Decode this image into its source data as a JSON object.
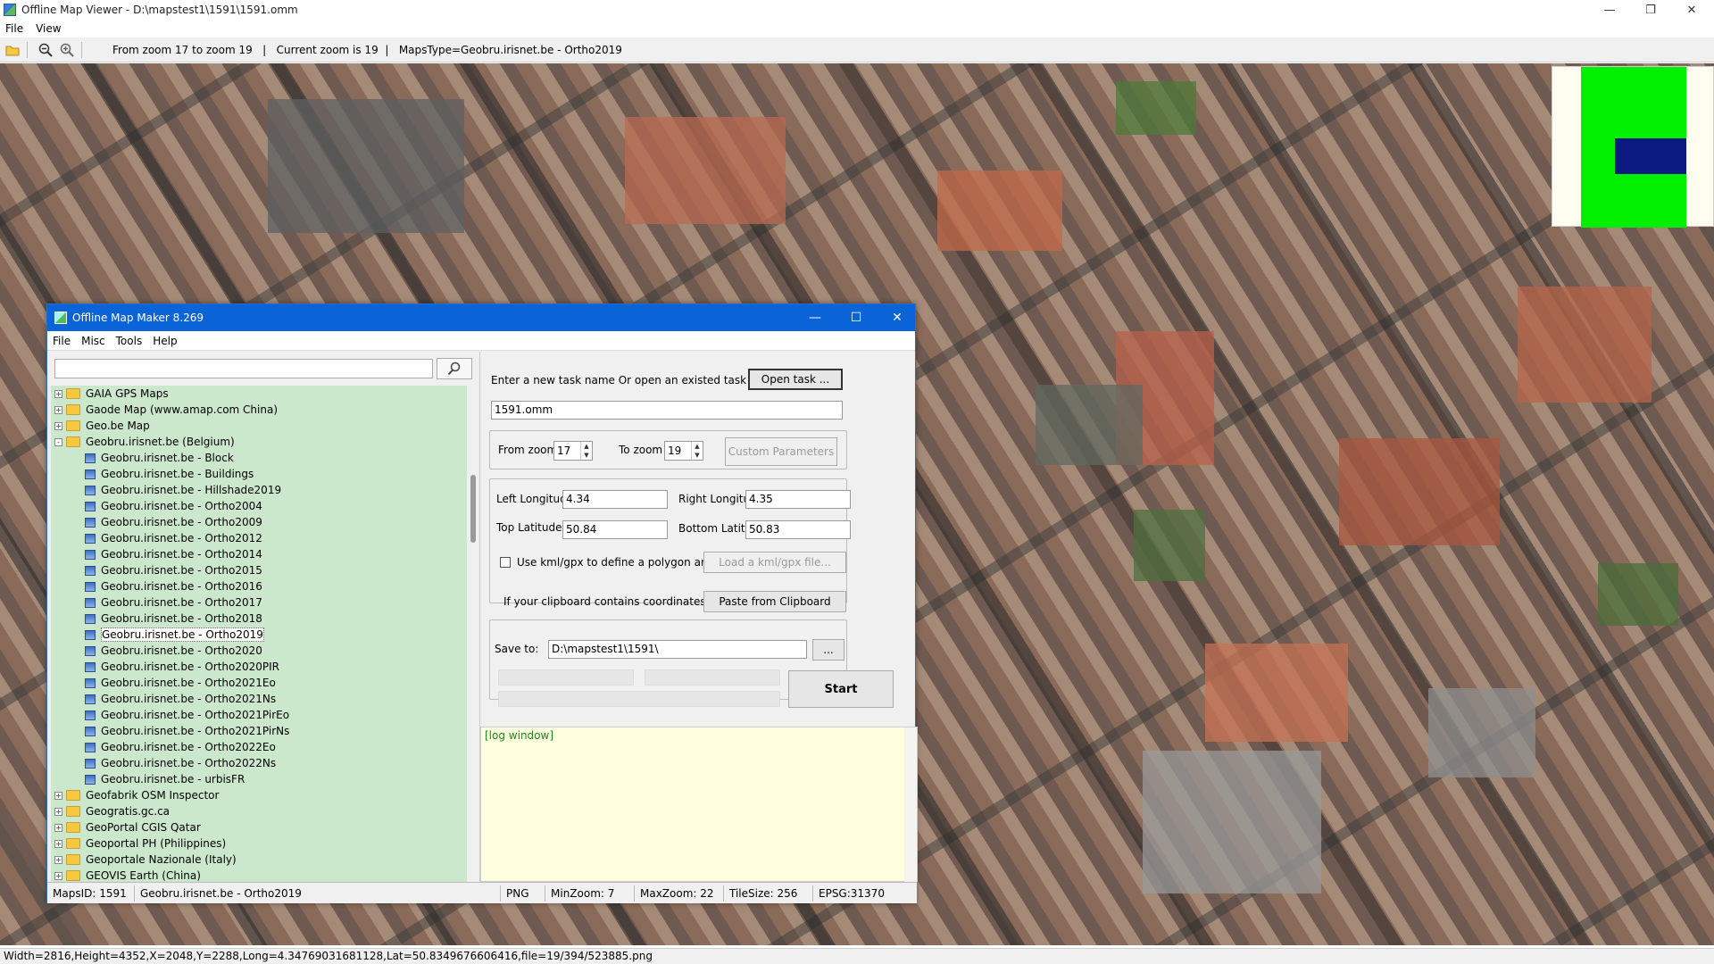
{
  "viewer": {
    "title": "Offline Map Viewer - D:\\mapstest1\\1591\\1591.omm",
    "menu": [
      "File",
      "View"
    ],
    "toolbar_info": "From zoom 17 to zoom 19   |   Current zoom is 19  |   MapsType=Geobru.irisnet.be - Ortho2019",
    "status": "Width=2816,Height=4352,X=2048,Y=2288,Long=4.34769031681128,Lat=50.8349676606416,file=19/394/523885.png",
    "minimap_colors": {
      "bg": "#fffdf0",
      "green": "#00f000",
      "blue": "#0a1a80"
    }
  },
  "dialog": {
    "title": "Offline Map Maker 8.269",
    "menu": [
      "File",
      "Misc",
      "Tools",
      "Help"
    ],
    "search_value": "",
    "tree": [
      {
        "label": "GAIA GPS Maps",
        "type": "folder",
        "expander": "+"
      },
      {
        "label": "Gaode Map (www.amap.com China)",
        "type": "folder",
        "expander": "+"
      },
      {
        "label": "Geo.be Map",
        "type": "folder",
        "expander": "+"
      },
      {
        "label": "Geobru.irisnet.be (Belgium)",
        "type": "folder",
        "expander": "-"
      },
      {
        "label": "Geobru.irisnet.be - Block",
        "type": "leaf"
      },
      {
        "label": "Geobru.irisnet.be - Buildings",
        "type": "leaf"
      },
      {
        "label": "Geobru.irisnet.be - Hillshade2019",
        "type": "leaf"
      },
      {
        "label": "Geobru.irisnet.be - Ortho2004",
        "type": "leaf"
      },
      {
        "label": "Geobru.irisnet.be - Ortho2009",
        "type": "leaf"
      },
      {
        "label": "Geobru.irisnet.be - Ortho2012",
        "type": "leaf"
      },
      {
        "label": "Geobru.irisnet.be - Ortho2014",
        "type": "leaf"
      },
      {
        "label": "Geobru.irisnet.be - Ortho2015",
        "type": "leaf"
      },
      {
        "label": "Geobru.irisnet.be - Ortho2016",
        "type": "leaf"
      },
      {
        "label": "Geobru.irisnet.be - Ortho2017",
        "type": "leaf"
      },
      {
        "label": "Geobru.irisnet.be - Ortho2018",
        "type": "leaf"
      },
      {
        "label": "Geobru.irisnet.be - Ortho2019",
        "type": "leaf",
        "selected": true
      },
      {
        "label": "Geobru.irisnet.be - Ortho2020",
        "type": "leaf"
      },
      {
        "label": "Geobru.irisnet.be - Ortho2020PIR",
        "type": "leaf"
      },
      {
        "label": "Geobru.irisnet.be - Ortho2021Eo",
        "type": "leaf"
      },
      {
        "label": "Geobru.irisnet.be - Ortho2021Ns",
        "type": "leaf"
      },
      {
        "label": "Geobru.irisnet.be - Ortho2021PirEo",
        "type": "leaf"
      },
      {
        "label": "Geobru.irisnet.be - Ortho2021PirNs",
        "type": "leaf"
      },
      {
        "label": "Geobru.irisnet.be - Ortho2022Eo",
        "type": "leaf"
      },
      {
        "label": "Geobru.irisnet.be - Ortho2022Ns",
        "type": "leaf"
      },
      {
        "label": "Geobru.irisnet.be - urbisFR",
        "type": "leaf"
      },
      {
        "label": "Geofabrik OSM Inspector",
        "type": "folder",
        "expander": "+"
      },
      {
        "label": "Geogratis.gc.ca",
        "type": "folder",
        "expander": "+"
      },
      {
        "label": "GeoPortal CGIS Qatar",
        "type": "folder",
        "expander": "+"
      },
      {
        "label": "Geoportal PH (Philippines)",
        "type": "folder",
        "expander": "+"
      },
      {
        "label": "Geoportale Nazionale (Italy)",
        "type": "folder",
        "expander": "+"
      },
      {
        "label": "GEOVIS Earth (China)",
        "type": "folder",
        "expander": "+"
      }
    ],
    "task_prompt": "Enter a new task name Or open an existed task to continue:",
    "open_task_label": "Open task ...",
    "task_name": "1591.omm",
    "from_zoom_label": "From zoom",
    "from_zoom": "17",
    "to_zoom_label": "To zoom",
    "to_zoom": "19",
    "custom_params_label": "Custom Parameters",
    "left_lon_label": "Left Longitude",
    "left_lon": "4.34",
    "right_lon_label": "Right Longitude",
    "right_lon": "4.35",
    "top_lat_label": "Top Latitude",
    "top_lat": "50.84",
    "bottom_lat_label": "Bottom Latitude",
    "bottom_lat": "50.83",
    "kml_check_label": "Use kml/gpx to define a polygon area",
    "load_kml_label": "Load a kml/gpx file...",
    "clipboard_prompt": "If your clipboard contains coordinates values:",
    "paste_label": "Paste from Clipboard",
    "save_to_label": "Save to:",
    "save_to": "D:\\mapstest1\\1591\\",
    "browse_label": "...",
    "start_label": "Start",
    "log_text": "[log window]",
    "status": {
      "maps_id": "MapsID: 1591",
      "map_name": "Geobru.irisnet.be - Ortho2019",
      "format": "PNG",
      "min_zoom": "MinZoom: 7",
      "max_zoom": "MaxZoom: 22",
      "tile_size": "TileSize: 256",
      "epsg": "EPSG:31370"
    }
  }
}
